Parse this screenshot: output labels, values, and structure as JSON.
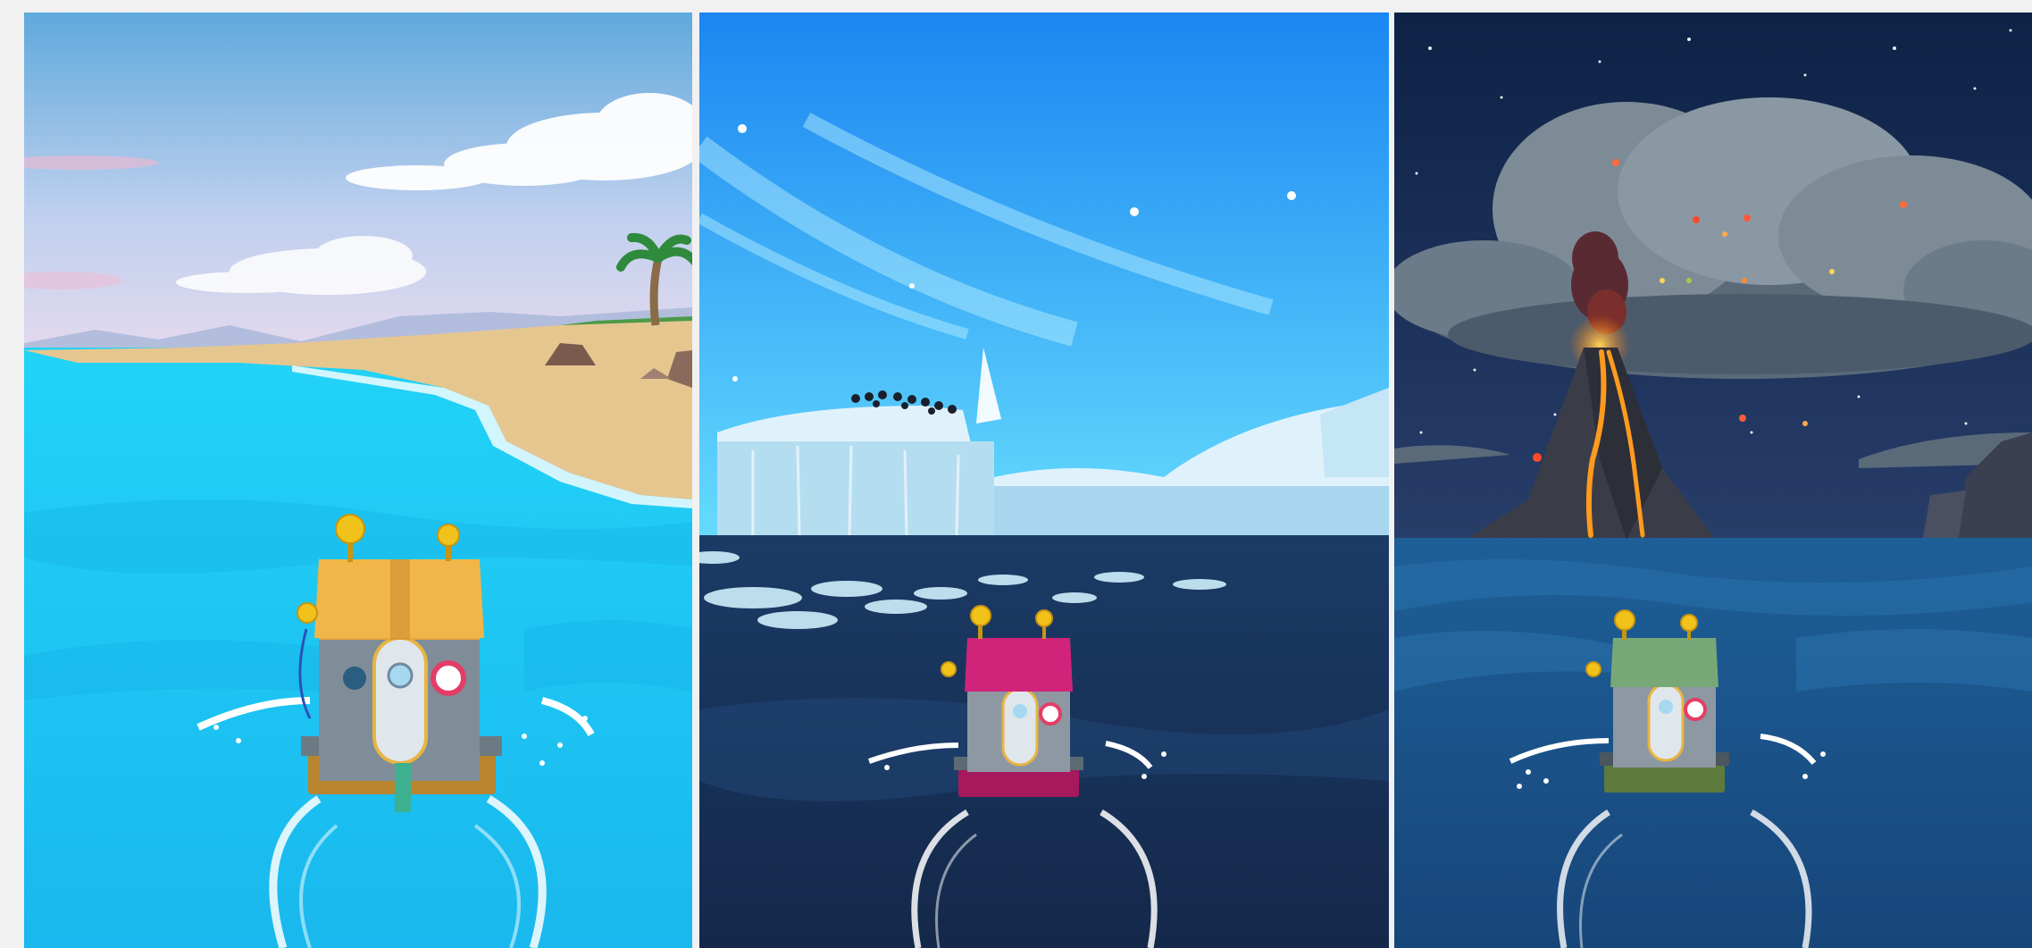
{
  "screenshots": [
    {
      "scene": "tropical-beach",
      "boat_color": "wooden-yellow",
      "colors": {
        "sky_top": "#5fa9dc",
        "sky_bottom": "#d7e2f4",
        "water": "#1ec7f5",
        "sand": "#e6c68f",
        "boat_roof": "#e7a83d"
      }
    },
    {
      "scene": "arctic-iceberg",
      "boat_color": "magenta",
      "colors": {
        "sky_top": "#1e8ff5",
        "sky_bottom": "#64dbfd",
        "water": "#17335c",
        "ice": "#d7eefb",
        "boat_roof": "#c4176e"
      }
    },
    {
      "scene": "night-volcano",
      "boat_color": "green",
      "colors": {
        "sky_top": "#0f2448",
        "sky_bottom": "#253a66",
        "water": "#1a5c96",
        "cloud": "#6c7b89",
        "lava": "#ff9a1e",
        "boat_roof": "#6a9a6a"
      }
    }
  ]
}
